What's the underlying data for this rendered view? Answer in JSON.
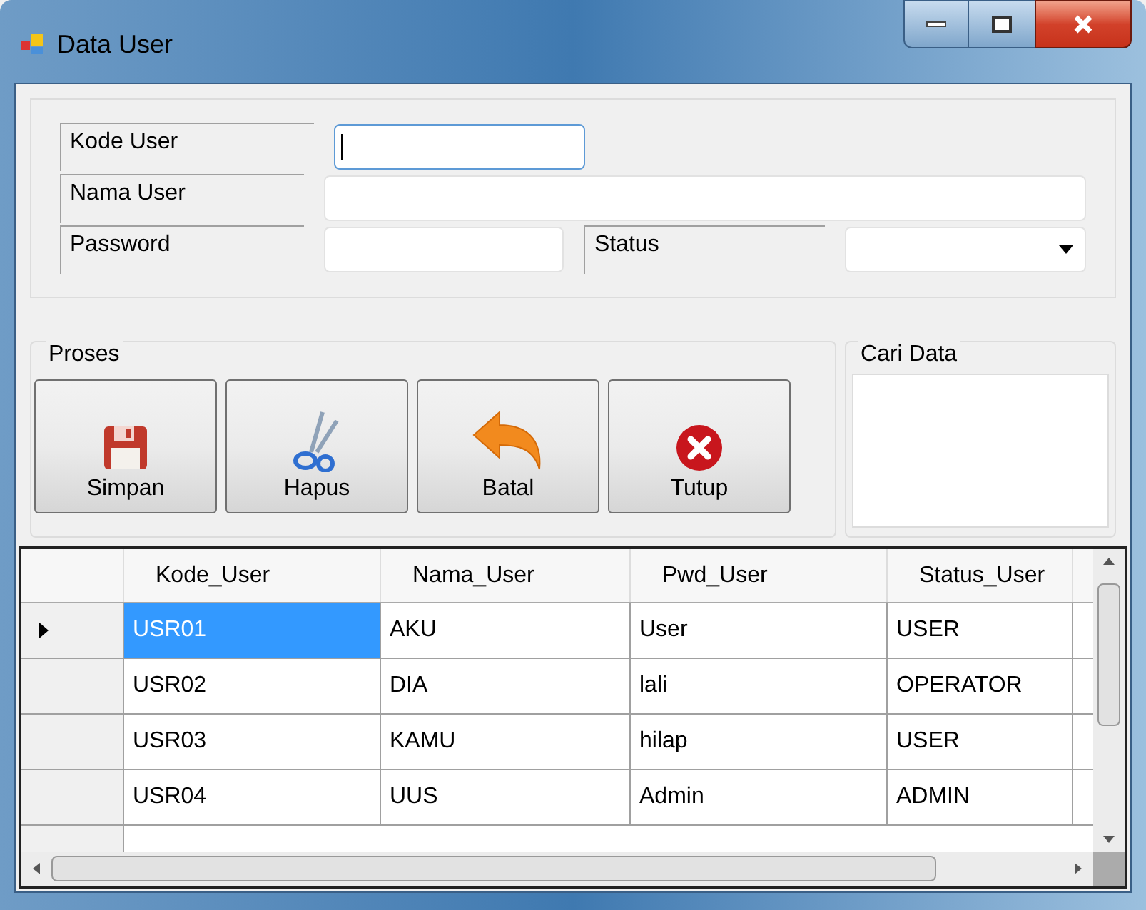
{
  "window": {
    "title": "Data User"
  },
  "form": {
    "fields": [
      {
        "label": "Kode User",
        "focused": true
      },
      {
        "label": "Nama User",
        "focused": false
      },
      {
        "label": "Password",
        "focused": false
      }
    ],
    "status": {
      "label": "Status"
    }
  },
  "proses": {
    "title": "Proses",
    "buttons": [
      "Simpan",
      "Hapus",
      "Batal",
      "Tutup"
    ]
  },
  "cari_data": {
    "title": "Cari Data"
  },
  "table": {
    "columns": [
      "Kode_User",
      "Nama_User",
      "Pwd_User",
      "Status_User"
    ],
    "rows": [
      {
        "cells": [
          "USR01",
          "AKU",
          "User",
          "USER"
        ],
        "selected": true
      },
      {
        "cells": [
          "USR02",
          "DIA",
          "lali",
          "OPERATOR"
        ],
        "selected": false
      },
      {
        "cells": [
          "USR03",
          "KAMU",
          "hilap",
          "USER"
        ],
        "selected": false
      },
      {
        "cells": [
          "USR04",
          "UUS",
          "Admin",
          "ADMIN"
        ],
        "selected": false
      }
    ]
  }
}
